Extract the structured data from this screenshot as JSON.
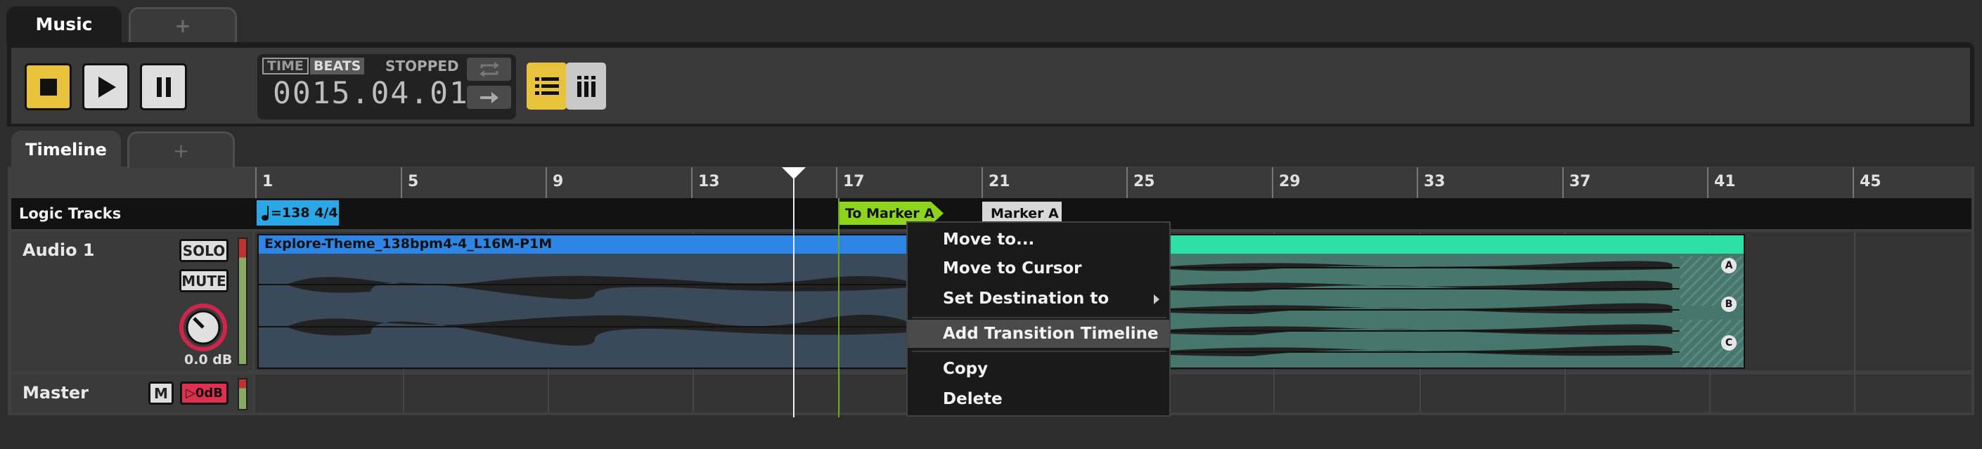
{
  "tabs": {
    "main": "Music",
    "add": "+"
  },
  "transport": {
    "time_tag": "TIME",
    "beats_tag": "BEATS",
    "status": "STOPPED",
    "position": "0015.04.01"
  },
  "timeline_tabs": {
    "active": "Timeline",
    "add": "+"
  },
  "ruler": {
    "labels": [
      "1",
      "5",
      "9",
      "13",
      "17",
      "21",
      "25",
      "29",
      "33",
      "37",
      "41",
      "45"
    ]
  },
  "logic_tracks": {
    "label": "Logic Tracks",
    "tempo_marker": "=138 4/4",
    "transition_marker": "To Marker A",
    "destination_marker": "Marker A"
  },
  "tracks": {
    "audio": {
      "name": "Audio 1",
      "solo": "SOLO",
      "mute": "MUTE",
      "volume": "0.0 dB",
      "clip_name": "Explore-Theme_138bpm4-4_L16M-P1M",
      "lanes": [
        "A",
        "B",
        "C"
      ]
    },
    "master": {
      "name": "Master",
      "mute": "M",
      "route": "▷0dB"
    }
  },
  "context_menu": {
    "items": [
      "Move to...",
      "Move to Cursor",
      "Set Destination to",
      "Add Transition Timeline",
      "Copy",
      "Delete"
    ]
  },
  "colors": {
    "accent": "#e8c23a",
    "clip_blue": "#2d86e6",
    "clip_teal": "#2de0a6",
    "marker_green": "#8ed41c",
    "tempo": "#2aa7e6"
  }
}
